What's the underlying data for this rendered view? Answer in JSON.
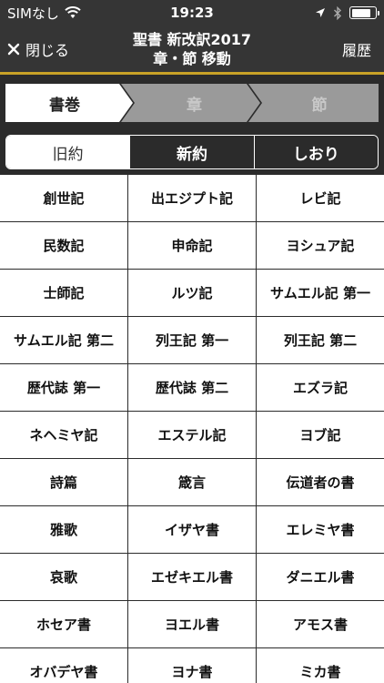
{
  "status": {
    "carrier": "SIMなし",
    "time": "19:23",
    "battery_level": 0.8
  },
  "nav": {
    "close_label": "閉じる",
    "title_line1": "聖書 新改訳2017",
    "title_line2": "章・節 移動",
    "history_label": "履歴"
  },
  "breadcrumb": [
    {
      "label": "書巻",
      "active": true
    },
    {
      "label": "章",
      "active": false
    },
    {
      "label": "節",
      "active": false
    }
  ],
  "segments": [
    {
      "label": "旧約",
      "active": true
    },
    {
      "label": "新約",
      "active": false
    },
    {
      "label": "しおり",
      "active": false
    }
  ],
  "books": [
    "創世記",
    "出エジプト記",
    "レビ記",
    "民数記",
    "申命記",
    "ヨシュア記",
    "士師記",
    "ルツ記",
    "サムエル記 第一",
    "サムエル記 第二",
    "列王記 第一",
    "列王記 第二",
    "歴代誌 第一",
    "歴代誌 第二",
    "エズラ記",
    "ネヘミヤ記",
    "エステル記",
    "ヨブ記",
    "詩篇",
    "箴言",
    "伝道者の書",
    "雅歌",
    "イザヤ書",
    "エレミヤ書",
    "哀歌",
    "エゼキエル書",
    "ダニエル書",
    "ホセア書",
    "ヨエル書",
    "アモス書",
    "オバデヤ書",
    "ヨナ書",
    "ミカ書"
  ]
}
